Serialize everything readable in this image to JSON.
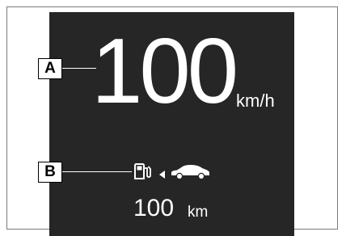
{
  "display": {
    "speed_value": "100",
    "speed_unit": "km/h",
    "range_value": "100",
    "range_unit": "km"
  },
  "callouts": {
    "a_label": "A",
    "b_label": "B"
  },
  "icons": {
    "fuel": "fuel-pump-icon",
    "arrow": "arrow-left-icon",
    "car": "car-icon"
  },
  "colors": {
    "screen_background": "#262626",
    "text": "#ffffff",
    "callout_border": "#000000"
  }
}
